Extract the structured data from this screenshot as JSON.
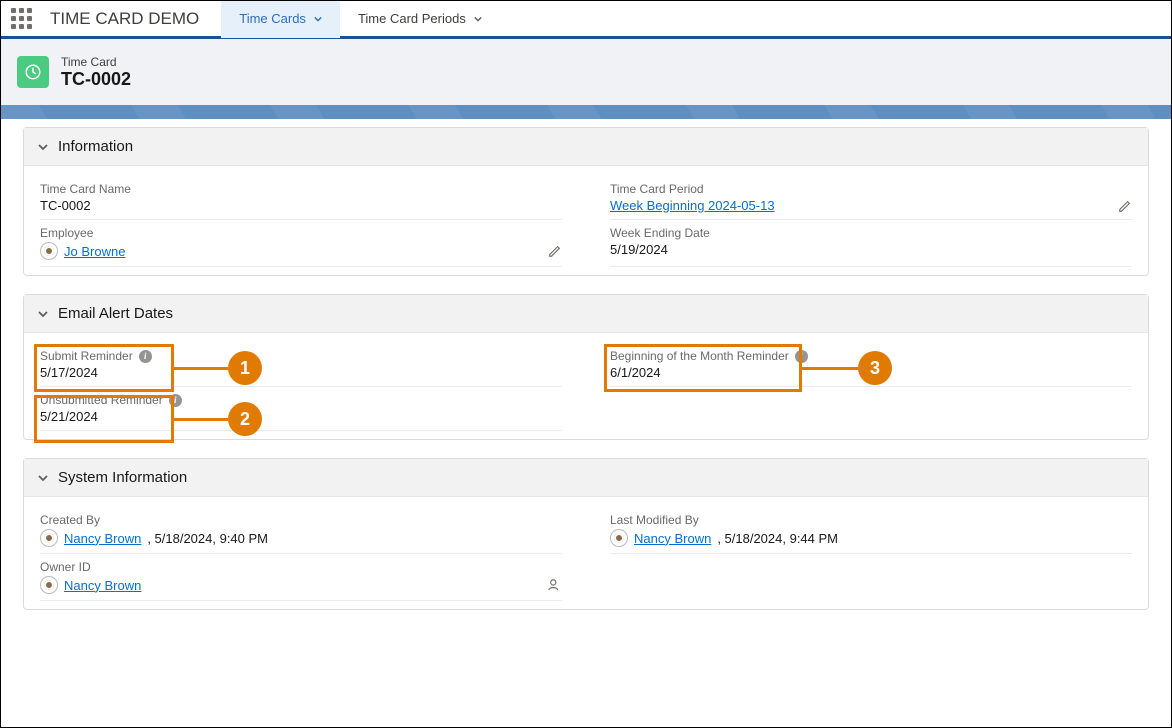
{
  "app": {
    "title": "TIME CARD DEMO",
    "tabs": [
      {
        "label": "Time Cards",
        "active": true
      },
      {
        "label": "Time Card Periods",
        "active": false
      }
    ]
  },
  "record": {
    "type_label": "Time Card",
    "name": "TC-0002"
  },
  "sections": {
    "information": {
      "title": "Information",
      "fields": {
        "time_card_name": {
          "label": "Time Card Name",
          "value": "TC-0002"
        },
        "time_card_period": {
          "label": "Time Card Period",
          "value": "Week Beginning 2024-05-13"
        },
        "employee": {
          "label": "Employee",
          "value": "Jo Browne"
        },
        "week_ending_date": {
          "label": "Week Ending Date",
          "value": "5/19/2024"
        }
      }
    },
    "email_alerts": {
      "title": "Email Alert Dates",
      "fields": {
        "submit_reminder": {
          "label": "Submit Reminder",
          "value": "5/17/2024"
        },
        "beginning_month": {
          "label": "Beginning of the Month Reminder",
          "value": "6/1/2024"
        },
        "unsubmitted_reminder": {
          "label": "Unsubmitted Reminder",
          "value": "5/21/2024"
        }
      }
    },
    "system_info": {
      "title": "System Information",
      "fields": {
        "created_by": {
          "label": "Created By",
          "user": "Nancy Brown",
          "timestamp": ", 5/18/2024, 9:40 PM"
        },
        "last_modified_by": {
          "label": "Last Modified By",
          "user": "Nancy Brown",
          "timestamp": ", 5/18/2024, 9:44 PM"
        },
        "owner_id": {
          "label": "Owner ID",
          "user": "Nancy Brown"
        }
      }
    }
  },
  "annotations": {
    "1": "1",
    "2": "2",
    "3": "3"
  }
}
